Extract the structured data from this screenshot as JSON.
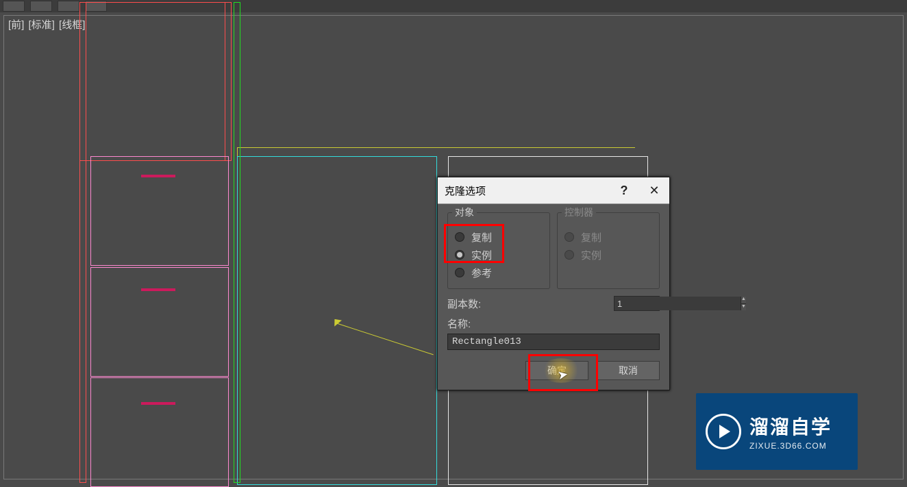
{
  "viewport": {
    "view": "[前]",
    "shading": "[标准]",
    "display": "[线框]"
  },
  "dialog": {
    "title": "克隆选项",
    "help_symbol": "?",
    "close_symbol": "✕",
    "object_group": "对象",
    "controller_group": "控制器",
    "radios": {
      "copy": "复制",
      "instance": "实例",
      "reference": "参考"
    },
    "object_selected": "instance",
    "copies_label": "副本数:",
    "copies_value": "1",
    "name_label": "名称:",
    "name_value": "Rectangle013",
    "ok": "确定",
    "cancel": "取消"
  },
  "watermark": {
    "title": "溜溜自学",
    "sub": "ZIXUE.3D66.COM"
  }
}
